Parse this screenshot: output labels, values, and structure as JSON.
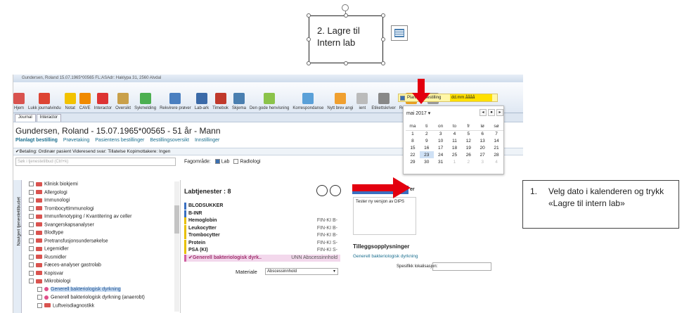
{
  "callout": {
    "text": "2. Lagre til Intern lab"
  },
  "note": {
    "number": "1.",
    "text": "Velg dato i kalenderen og trykk «Lagre til intern lab»"
  },
  "window": {
    "title": "Gundersen, Roland 15.07.1965*00565 FL:ASAdr: Haklypa 31, 2560 Alvdal"
  },
  "ribbon": [
    {
      "label": "Hjem",
      "color": "#d9534f"
    },
    {
      "label": "Lukk journalvindu",
      "color": "#d43"
    },
    {
      "label": "Notat",
      "color": "#f2c200"
    },
    {
      "label": "CAVE",
      "color": "#f08a00"
    },
    {
      "label": "Interactor",
      "color": "#d33"
    },
    {
      "label": "Oversikt",
      "color": "#c9a04a"
    },
    {
      "label": "Sykmelding",
      "color": "#4caf50"
    },
    {
      "label": "Rekvirere prøver",
      "color": "#4a7fc0"
    },
    {
      "label": "Lab-ark",
      "color": "#3b6aa8"
    },
    {
      "label": "Timebok",
      "color": "#c0392b"
    },
    {
      "label": "Skjema",
      "color": "#4a7fb0"
    },
    {
      "label": "Den gode henvisning",
      "color": "#8bc34a"
    },
    {
      "label": "Korrespondanse",
      "color": "#5aa0d8"
    },
    {
      "label": "Nytt brev angi",
      "color": "#f0a030"
    },
    {
      "label": "ient",
      "color": "#bbb"
    },
    {
      "label": "Etikettskriver",
      "color": "#888"
    },
    {
      "label": "Regningskort",
      "color": "#e8a020"
    },
    {
      "label": "Husk",
      "color": "#999"
    }
  ],
  "tabs": [
    "Journal",
    "Interactor"
  ],
  "patient": {
    "title": "Gundersen, Roland - 15.07.1965*00565 - 51 år - Mann"
  },
  "subtabs": [
    "Planlagt bestilling",
    "Prøvetaking",
    "Pasientens bestillinger",
    "Bestillingsoversikt",
    "Innstillinger"
  ],
  "betaling": "✔Betaling: Ordinær pasient Videresend svar: Tillatelse Kopimottakere: Ingen",
  "search_placeholder": "Søk i tjenestetilbud (Ctrl+k)",
  "fagomrade": {
    "label": "Fagområde:",
    "lab": "Lab",
    "radiologi": "Radiologi"
  },
  "sidebar_label": "Navigeri tjenestetilbudet",
  "tree": [
    "Klinisk biokjemi",
    "Allergologi",
    "Immunologi",
    "Trombocyttimmunologi",
    "Immunfenotyping / Kvantitering av celler",
    "Svangerskapsanalyser",
    "Blodtype",
    "Pretransfusjonsundersøkelse",
    "Legemidler",
    "Rusmidler",
    "Fæces-analyser gastrolab",
    "Kopisvar",
    "Mikrobiologi",
    "Generell bakteriologisk dyrkning",
    "Generell bakteriologisk dyrkning (anaerobt)",
    "Luftveisdiagnostikk"
  ],
  "labtjenester": {
    "title": "Labtjenester : 8",
    "rows": [
      {
        "name": "BLODSUKKER",
        "code": "",
        "color": "#3a6fc0"
      },
      {
        "name": "B-INR",
        "code": "",
        "color": "#3a6fc0"
      },
      {
        "name": "Hemoglobin",
        "code": "FIN-KI B-",
        "color": "#e8c000"
      },
      {
        "name": "Leukocytter",
        "code": "FIN-KI B-",
        "color": "#e8c000"
      },
      {
        "name": "Trombocytter",
        "code": "FIN-KI B-",
        "color": "#e8c000"
      },
      {
        "name": "Protein",
        "code": "FIN-KI S-",
        "color": "#e8c000"
      },
      {
        "name": "PSA (KI)",
        "code": "FIN-KI S-",
        "color": "#e8c000"
      },
      {
        "name": "✔Generell bakteriologisk dyrk..",
        "code": "UNN Abscessinnhold",
        "color": "#d060a0"
      }
    ],
    "materiale_label": "Materiale",
    "materiale_value": "Abscessinnhold"
  },
  "right": {
    "tab_fragment": "er",
    "notat": "Tester ny versjon av DIPS",
    "tillegg": "Tilleggsopplysninger",
    "tillegg_item": "Generell bakteriologisk dyrkning",
    "lokalisasjon_label": "Spesifikk lokalisasjon:"
  },
  "planlegg": {
    "label": "Planlegg bestilling",
    "date_placeholder": "dd.mm.åååå"
  },
  "calendar": {
    "month": "mai 2017 ▾",
    "days": [
      "ma",
      "ti",
      "on",
      "to",
      "fr",
      "lø",
      "sø"
    ],
    "weeks": [
      [
        "1",
        "2",
        "3",
        "4",
        "5",
        "6",
        "7"
      ],
      [
        "8",
        "9",
        "10",
        "11",
        "12",
        "13",
        "14"
      ],
      [
        "15",
        "16",
        "17",
        "18",
        "19",
        "20",
        "21"
      ],
      [
        "22",
        "23",
        "24",
        "25",
        "26",
        "27",
        "28"
      ],
      [
        "29",
        "30",
        "31",
        "1",
        "2",
        "3",
        "4"
      ]
    ]
  },
  "colors": {
    "accent": "#1a6e8e",
    "arrow": "#e3000f"
  }
}
